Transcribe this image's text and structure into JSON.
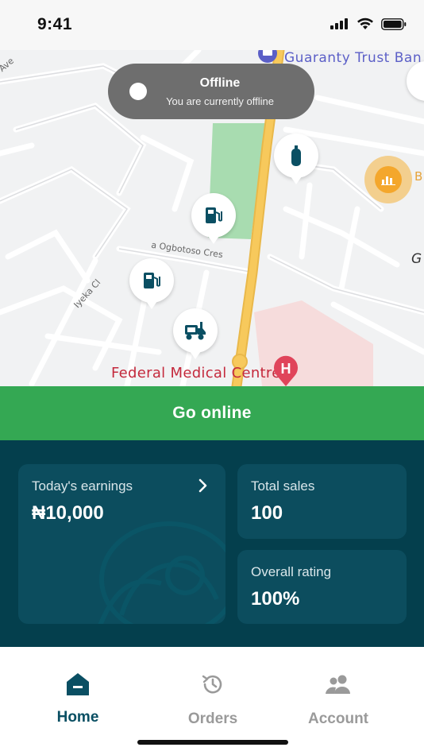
{
  "status_bar": {
    "time": "9:41",
    "icons": [
      "cellular-signal-icon",
      "wifi-icon",
      "battery-icon"
    ]
  },
  "map": {
    "labels": {
      "bank": "Guaranty Trust Ban",
      "hospital": "Federal Medical Centre",
      "street_1": "a Ogbotoso Cres",
      "street_2": "Iyeka Cl",
      "street_3": "Ave",
      "edge_g": "G",
      "edge_b": "B"
    },
    "markers": [
      "gas-cylinder-icon",
      "fuel-pump-icon",
      "fuel-pump-icon",
      "delivery-truck-icon",
      "hospital-icon",
      "bank-icon",
      "stats-icon"
    ],
    "offline_banner": {
      "title": "Offline",
      "subtitle": "You are currently offline"
    }
  },
  "go_online": {
    "label": "Go online"
  },
  "stats": {
    "earnings": {
      "label": "Today's earnings",
      "value": "₦10,000"
    },
    "sales": {
      "label": "Total sales",
      "value": "100"
    },
    "rating": {
      "label": "Overall rating",
      "value": "100%"
    }
  },
  "nav": {
    "home": "Home",
    "orders": "Orders",
    "account": "Account"
  },
  "colors": {
    "primary_green": "#34a853",
    "dark_teal": "#043f4d",
    "card_teal": "#0c4d5e",
    "active_nav": "#0a4f63",
    "hospital_red": "#c4293c",
    "road_yellow": "#f7c95c"
  }
}
